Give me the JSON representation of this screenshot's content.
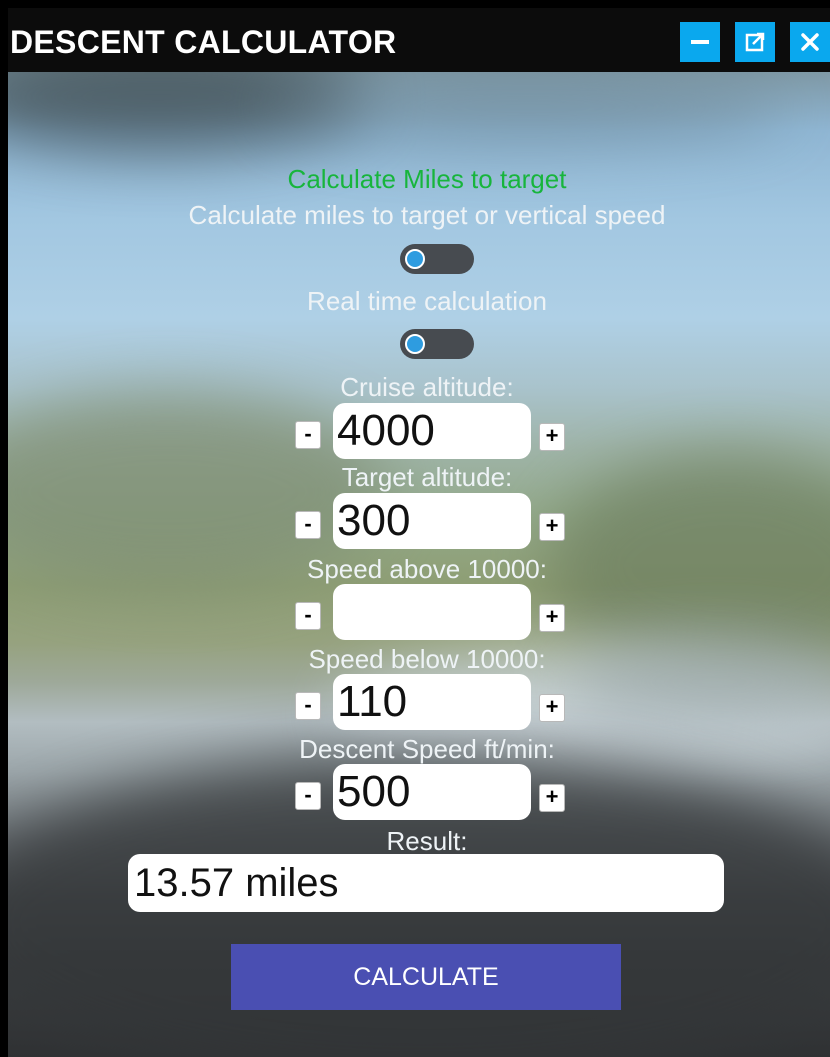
{
  "window": {
    "title": "DESCENT CALCULATOR",
    "minimize_icon": "minimize-icon",
    "popout_icon": "popout-icon",
    "close_icon": "close-icon",
    "accent_color": "#0aa8ee"
  },
  "mode": {
    "heading": "Calculate Miles to target",
    "heading_color": "#17b53c",
    "description": "Calculate miles to target or vertical speed",
    "toggle_on": false
  },
  "realtime": {
    "label": "Real time calculation",
    "toggle_on": false
  },
  "fields": [
    {
      "label": "Cruise altitude:",
      "value": "4000",
      "minus": "-",
      "plus": "+"
    },
    {
      "label": "Target altitude:",
      "value": "300",
      "minus": "-",
      "plus": "+"
    },
    {
      "label": "Speed above 10000:",
      "value": "",
      "minus": "-",
      "plus": "+"
    },
    {
      "label": "Speed below 10000:",
      "value": "110",
      "minus": "-",
      "plus": "+"
    },
    {
      "label": "Descent Speed ft/min:",
      "value": "500",
      "minus": "-",
      "plus": "+"
    }
  ],
  "result": {
    "label": "Result:",
    "value": "13.57 miles"
  },
  "calculate": {
    "label": "CALCULATE",
    "color": "#4a4fb2"
  }
}
